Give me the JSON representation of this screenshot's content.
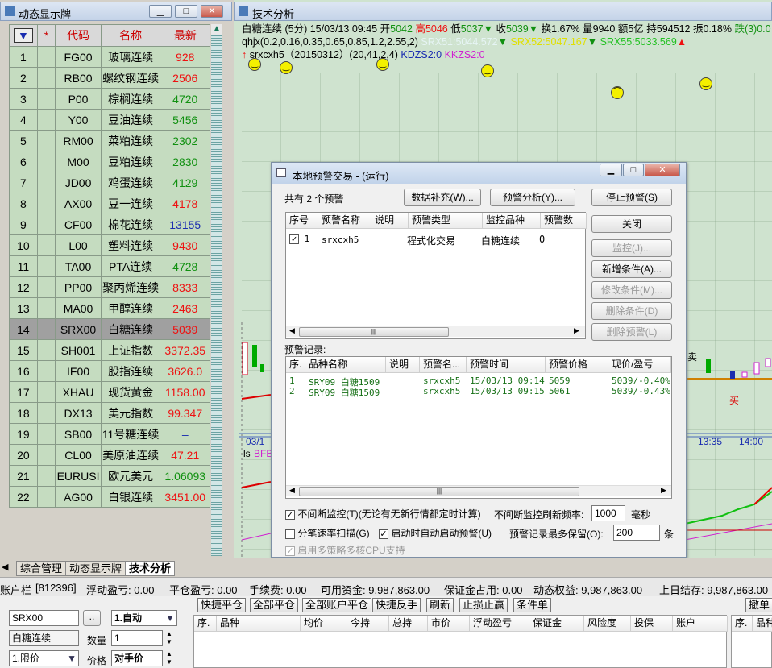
{
  "left_panel": {
    "title": "动态显示牌",
    "columns": [
      "▼",
      "*",
      "代码",
      "名称",
      "最新"
    ],
    "rows": [
      {
        "n": "1",
        "code": "FG00",
        "name": "玻璃连续",
        "last": "928",
        "c": "up"
      },
      {
        "n": "2",
        "code": "RB00",
        "name": "螺纹钢连续",
        "last": "2506",
        "c": "up"
      },
      {
        "n": "3",
        "code": "P00",
        "name": "棕榈连续",
        "last": "4720",
        "c": "dn"
      },
      {
        "n": "4",
        "code": "Y00",
        "name": "豆油连续",
        "last": "5456",
        "c": "dn"
      },
      {
        "n": "5",
        "code": "RM00",
        "name": "菜粕连续",
        "last": "2302",
        "c": "dn"
      },
      {
        "n": "6",
        "code": "M00",
        "name": "豆粕连续",
        "last": "2830",
        "c": "dn"
      },
      {
        "n": "7",
        "code": "JD00",
        "name": "鸡蛋连续",
        "last": "4129",
        "c": "dn"
      },
      {
        "n": "8",
        "code": "AX00",
        "name": "豆一连续",
        "last": "4178",
        "c": "up"
      },
      {
        "n": "9",
        "code": "CF00",
        "name": "棉花连续",
        "last": "13155",
        "c": "bl"
      },
      {
        "n": "10",
        "code": "L00",
        "name": "塑料连续",
        "last": "9430",
        "c": "up"
      },
      {
        "n": "11",
        "code": "TA00",
        "name": "PTA连续",
        "last": "4728",
        "c": "dn"
      },
      {
        "n": "12",
        "code": "PP00",
        "name": "聚丙烯连续",
        "last": "8333",
        "c": "up"
      },
      {
        "n": "13",
        "code": "MA00",
        "name": "甲醇连续",
        "last": "2463",
        "c": "up"
      },
      {
        "n": "14",
        "code": "SRX00",
        "name": "白糖连续",
        "last": "5039",
        "c": "up",
        "sel": true
      },
      {
        "n": "15",
        "code": "SH001",
        "name": "上证指数",
        "last": "3372.35",
        "c": "up"
      },
      {
        "n": "16",
        "code": "IF00",
        "name": "股指连续",
        "last": "3626.0",
        "c": "up"
      },
      {
        "n": "17",
        "code": "XHAU",
        "name": "现货黄金",
        "last": "1158.00",
        "c": "up"
      },
      {
        "n": "18",
        "code": "DX13",
        "name": "美元指数",
        "last": "99.347",
        "c": "up"
      },
      {
        "n": "19",
        "code": "SB00",
        "name": "11号糖连续",
        "last": "–",
        "c": "bl"
      },
      {
        "n": "20",
        "code": "CL00",
        "name": "美原油连续",
        "last": "47.21",
        "c": "up"
      },
      {
        "n": "21",
        "code": "EURUSI",
        "name": "欧元美元",
        "last": "1.06093",
        "c": "dn"
      },
      {
        "n": "22",
        "code": "AG00",
        "name": "白银连续",
        "last": "3451.00",
        "c": "up"
      }
    ]
  },
  "chart": {
    "title": "技术分析",
    "line1": {
      "symbol": "白糖连续 (5分) 15/03/13 09:45",
      "open_l": "开",
      "open": "5042",
      "high_l": "高",
      "high": "5046",
      "low_l": "低",
      "low": "5037▼",
      "close_l": "收",
      "close": "5039▼",
      "chg": "换1.67%",
      "vol": "量9940",
      "amt": "额5亿",
      "oi": "持594512",
      "amp": "振0.18%",
      "fall": "跌(3)0.0"
    },
    "line2": {
      "params": "qhjx(0.2,0.16,0.35,0.65,0.85,1.2,2.55,2)",
      "srx51": "SRX51:5044.572",
      "srx52": "SRX52:5047.167",
      "srx55": "SRX55:5033.569"
    },
    "line3": {
      "ind": "srxcxh5（20150312）(20,41,2,4)",
      "kdzs": "KDZS2:0",
      "kkzs": "KKZS2:0"
    },
    "times": [
      "03/1",
      "13:35",
      "14:00"
    ],
    "sell": "卖",
    "buy": "买",
    "lsl": "ls",
    "bfb": "BFB"
  },
  "dialog": {
    "title": "本地预警交易 - (运行)",
    "count": "共有 2 个预警",
    "btn_data": "数据补充(W)...",
    "btn_analysis": "预警分析(Y)...",
    "btn_stop": "停止预警(S)",
    "btn_close": "关闭",
    "btn_monitor": "监控(J)...",
    "btn_add": "新增条件(A)...",
    "btn_edit": "修改条件(M)...",
    "btn_del_cond": "删除条件(D)",
    "btn_del_alert": "删除预警(L)",
    "alert_cols": [
      "序号",
      "预警名称",
      "说明",
      "预警类型",
      "监控品种",
      "预警数"
    ],
    "alerts": [
      {
        "no": "1",
        "name": "srxcxh5",
        "desc": "",
        "type": "程式化交易",
        "symbol": "白糖连续",
        "count": "0"
      }
    ],
    "rec_label": "预警记录:",
    "rec_cols": [
      "序.",
      "品种名称",
      "说明",
      "预警名...",
      "预警时间",
      "预警价格",
      "现价/盈亏"
    ],
    "records": [
      {
        "no": "1",
        "sym": "SRY09 白糖1509",
        "desc": "",
        "name": "srxcxh5",
        "time": "15/03/13 09:14",
        "price": "5059",
        "pnl": "5039/-0.40%"
      },
      {
        "no": "2",
        "sym": "SRY09 白糖1509",
        "desc": "",
        "name": "srxcxh5",
        "time": "15/03/13 09:15",
        "price": "5061",
        "pnl": "5039/-0.43%"
      }
    ],
    "opt_continuous": "不间断监控(T)(无论有无新行情都定时计算)",
    "freq_label": "不间断监控刷新频率:",
    "freq": "1000",
    "freq_unit": "毫秒",
    "opt_tick": "分笔速率扫描(G)",
    "opt_autostart": "启动时自动启动预警(U)",
    "keep_label": "预警记录最多保留(O):",
    "keep": "200",
    "keep_unit": "条",
    "opt_multicore": "启用多策略多核CPU支持"
  },
  "tabs": [
    "综合管理",
    "动态显示牌",
    "技术分析"
  ],
  "account": {
    "acct": "账户栏",
    "id": "[812396]",
    "float": "浮动盈亏: 0.00",
    "close_pnl": "平仓盈亏: 0.00",
    "fee": "手续费: 0.00",
    "avail": "可用资金: 9,987,863.00",
    "margin": "保证金占用: 0.00",
    "equity": "动态权益: 9,987,863.00",
    "prev": "上日结存: 9,987,863.00"
  },
  "trade": {
    "code": "SRX00",
    "name": "白糖连续",
    "mode": "1.自动",
    "qty_label": "数量",
    "qty": "1",
    "type": "1.限价",
    "price_label": "价格",
    "price": "对手价",
    "buttons": [
      "快捷平仓",
      "全部平仓",
      "全部账户平仓",
      "快捷反手",
      "刷新",
      "止损止赢",
      "条件单"
    ],
    "cancel": "撤单",
    "cols": [
      "序.",
      "品种",
      "均价",
      "今持",
      "总持",
      "市价",
      "浮动盈亏",
      "保证金",
      "风险度",
      "投保",
      "账户"
    ],
    "cols2": [
      "序.",
      "品种"
    ]
  }
}
